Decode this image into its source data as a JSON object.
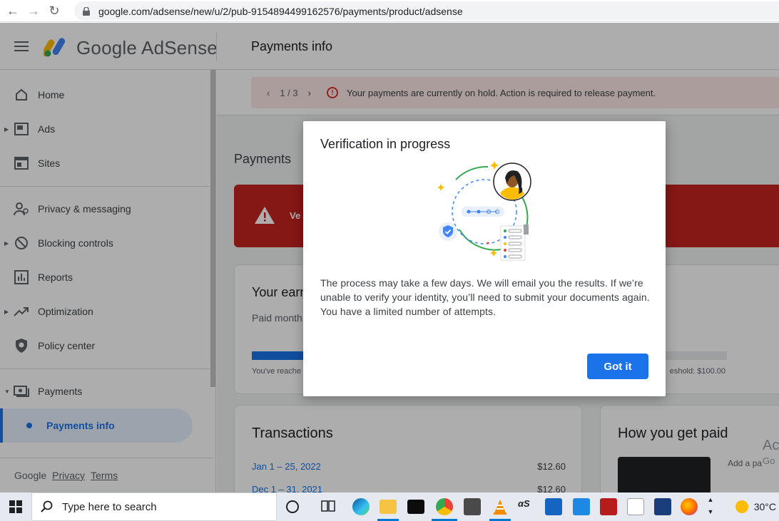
{
  "browser": {
    "url": "google.com/adsense/new/u/2/pub-9154894499162576/payments/product/adsense"
  },
  "header": {
    "brand": "Google AdSense",
    "page_title": "Payments info"
  },
  "sidebar": {
    "items": [
      {
        "label": "Home",
        "icon": "home-icon"
      },
      {
        "label": "Ads",
        "icon": "ads-icon"
      },
      {
        "label": "Sites",
        "icon": "sites-icon"
      },
      {
        "label": "Privacy & messaging",
        "icon": "privacy-icon"
      },
      {
        "label": "Blocking controls",
        "icon": "block-icon"
      },
      {
        "label": "Reports",
        "icon": "reports-icon"
      },
      {
        "label": "Optimization",
        "icon": "trending-icon"
      },
      {
        "label": "Policy center",
        "icon": "shield-icon"
      },
      {
        "label": "Payments",
        "icon": "payments-icon"
      }
    ],
    "sub_item": "Payments info",
    "footer": {
      "google": "Google",
      "privacy": "Privacy",
      "terms": "Terms"
    }
  },
  "main": {
    "alert": {
      "page": "1 / 3",
      "message": "Your payments are currently on hold. Action is required to release payment."
    },
    "section_title": "Payments",
    "banner_text": "Ve",
    "earnings": {
      "title": "Your earn",
      "subtitle": "Paid month",
      "reached": "You've reache",
      "threshold": "eshold: $100.00",
      "progress": 0.11
    },
    "transactions": {
      "title": "Transactions",
      "rows": [
        {
          "date": "Jan 1 – 25, 2022",
          "amount": "$12.60"
        },
        {
          "date": "Dec 1 – 31, 2021",
          "amount": "$12.60"
        }
      ]
    },
    "how_paid": {
      "title": "How you get paid",
      "add": "Add a pa"
    },
    "activate": {
      "line1": "Ac",
      "line2": "Go"
    }
  },
  "dialog": {
    "title": "Verification in progress",
    "body": "The process may take a few days. We will email you the results. If we’re unable to verify your identity, you’ll need to submit your documents again. You have a limited number of attempts.",
    "button": "Got it"
  },
  "taskbar": {
    "search_placeholder": "Type here to search",
    "temperature": "30°C"
  },
  "colors": {
    "accent": "#1a73e8",
    "danger": "#c5221f"
  }
}
